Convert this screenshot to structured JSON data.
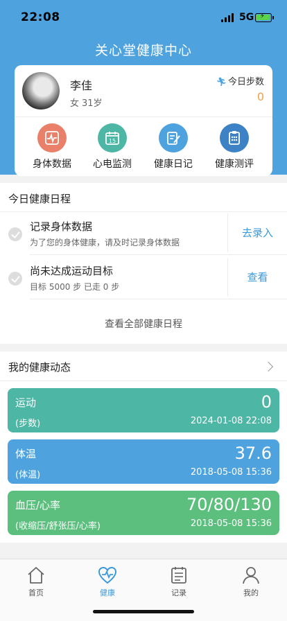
{
  "status_bar": {
    "time": "22:08",
    "network": "5G"
  },
  "app_title": "关心堂健康中心",
  "profile": {
    "name": "李佳",
    "gender": "女",
    "age": "31岁",
    "steps_label": "今日步数",
    "steps_value": "0"
  },
  "quick_actions": [
    {
      "label": "身体数据",
      "icon": "body-data-icon",
      "color": "#e8806a"
    },
    {
      "label": "心电监测",
      "icon": "calendar-icon",
      "color": "#4db6a4"
    },
    {
      "label": "健康日记",
      "icon": "diary-icon",
      "color": "#4ea3df"
    },
    {
      "label": "健康测评",
      "icon": "assessment-icon",
      "color": "#3d82c4"
    }
  ],
  "schedule": {
    "title": "今日健康日程",
    "tasks": [
      {
        "title": "记录身体数据",
        "desc": "为了您的身体健康，请及时记录身体数据",
        "action": "去录入"
      },
      {
        "title": "尚未达成运动目标",
        "desc": "目标 5000 步  已走 0 步",
        "action": "查看"
      }
    ],
    "view_all": "查看全部健康日程"
  },
  "dynamics": {
    "title": "我的健康动态",
    "metrics": [
      {
        "name": "运动",
        "unit": "(步数)",
        "value": "0",
        "time": "2024-01-08 22:08",
        "color": "#4db6a4"
      },
      {
        "name": "体温",
        "unit": "(体温)",
        "value": "37.6",
        "time": "2018-05-08 15:36",
        "color": "#4ea3df"
      },
      {
        "name": "血压/心率",
        "unit": "(收缩压/舒张压/心率)",
        "value": "70/80/130",
        "time": "2018-05-08 15:36",
        "color": "#5cbf7e"
      }
    ]
  },
  "tabbar": {
    "tabs": [
      {
        "label": "首页",
        "icon": "home-icon"
      },
      {
        "label": "健康",
        "icon": "heart-pulse-icon",
        "active": true
      },
      {
        "label": "记录",
        "icon": "record-icon"
      },
      {
        "label": "我的",
        "icon": "user-icon"
      }
    ]
  }
}
